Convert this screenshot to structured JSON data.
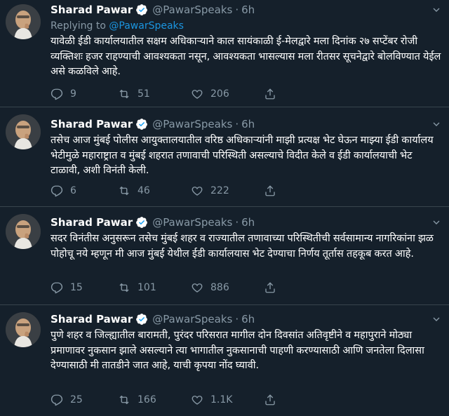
{
  "theme": {
    "background": "#15202b",
    "text": "#ffffff",
    "muted": "#8899a6",
    "link": "#1b95e0",
    "verified": "#1da1f2",
    "divider": "#38444d"
  },
  "tweets": [
    {
      "name": "Sharad Pawar",
      "handle": "@PawarSpeaks",
      "dot": "·",
      "time": "6h",
      "replying_prefix": "Replying to",
      "replying_mention": "@PawarSpeaks",
      "text": "यावेळी ईडी कार्यालयातील सक्षम अधिकाऱ्याने काल सायंकाळी ई-मेलद्वारे मला दिनांक २७ सप्टेंबर रोजी व्यक्तिशः हजर राहण्याची आवश्यकता नसून, आवश्यकता भासल्यास मला रीतसर सूचनेद्वारे बोलविण्यात येईल असे कळविले आहे.",
      "replies": "9",
      "retweets": "51",
      "likes": "206"
    },
    {
      "name": "Sharad Pawar",
      "handle": "@PawarSpeaks",
      "dot": "·",
      "time": "6h",
      "text": "तसेच आज मुंबई पोलीस आयुक्तालयातील वरिष्ठ अधिकाऱ्यांनी माझी प्रत्यक्ष भेट घेऊन माझ्या ईडी कार्यालय भेटीमुळे महाराष्ट्रात व मुंबई शहरात तणावाची परिस्थिती असल्याचे विदीत केले व ईडी कार्यालयाची भेट टाळावी, अशी विनंती केली.",
      "replies": "6",
      "retweets": "46",
      "likes": "222"
    },
    {
      "name": "Sharad Pawar",
      "handle": "@PawarSpeaks",
      "dot": "·",
      "time": "6h",
      "text": "सदर विनंतीस अनुसरून तसेच मुंबई शहर व राज्यातील तणावाच्या परिस्थितीची सर्वसामान्य नागरिकांना झळ पोहोचू नये म्हणून मी आज मुंबई येथील ईडी कार्यालयास भेट देण्याचा निर्णय तूर्तास तहकूब करत आहे.",
      "replies": "15",
      "retweets": "101",
      "likes": "886"
    },
    {
      "name": "Sharad Pawar",
      "handle": "@PawarSpeaks",
      "dot": "·",
      "time": "6h",
      "text": "पुणे शहर व जिल्ह्यातील बारामती, पुरंदर परिसरात मागील दोन दिवसांत अतिवृष्टीने व महापुराने मोठ्या प्रमाणावर नुकसान झाले असल्याने त्या भागातील नुकसानाची पाहणी करण्यासाठी आणि जनतेला दिलासा देण्यासाठी मी तातडीने जात आहे, याची कृपया नोंद घ्यावी.",
      "replies": "25",
      "retweets": "166",
      "likes": "1.1K"
    }
  ],
  "icons": {
    "avatar": "avatar-photo",
    "verified": "verified-badge-icon",
    "caret": "chevron-down-icon",
    "reply": "reply-icon",
    "retweet": "retweet-icon",
    "like": "heart-icon",
    "share": "share-icon"
  }
}
